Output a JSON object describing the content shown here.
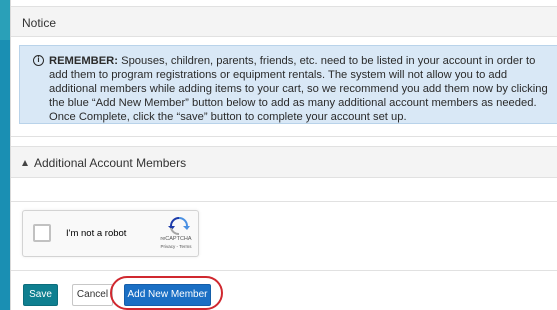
{
  "notice": {
    "title": "Notice",
    "remember_label": "REMEMBER:",
    "message": "Spouses, children, parents, friends, etc. need to be listed in your account in order to add them to program registrations or equipment rentals. The system will not allow you to add additional members while adding items to your cart, so we recommend you add them now by clicking the blue “Add New Member” button below to add as many additional account members as needed. Once Complete, click the “save” button to complete your account set up.",
    "icon": "info-icon"
  },
  "members_section": {
    "title": "Additional Account Members",
    "toggle_icon": "caret-up-icon"
  },
  "captcha": {
    "label": "I'm not a robot",
    "brand": "reCAPTCHA",
    "links": "Privacy - Terms"
  },
  "actions": {
    "save_label": "Save",
    "cancel_label": "Cancel",
    "add_member_label": "Add New Member"
  },
  "colors": {
    "save_button": "#0f7f90",
    "add_member_button": "#1a6fc4",
    "notice_background": "#d9e8f6",
    "highlight_ring": "#d0282f",
    "page_background": "#1a8fb3"
  }
}
